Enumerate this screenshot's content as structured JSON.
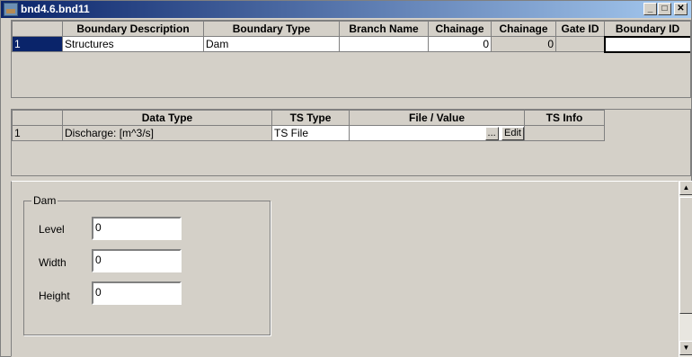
{
  "window": {
    "title": "bnd4.6.bnd11",
    "minimize": "_",
    "maximize": "□",
    "close": "✕"
  },
  "boundary_table": {
    "headers": [
      "",
      "Boundary Description",
      "Boundary Type",
      "Branch Name",
      "Chainage",
      "Chainage",
      "Gate ID",
      "Boundary ID"
    ],
    "rows": [
      [
        "1",
        "Structures",
        "Dam",
        "",
        "0",
        "0",
        "",
        ""
      ]
    ]
  },
  "ts_table": {
    "headers": [
      "",
      "Data Type",
      "TS Type",
      "File / Value",
      "TS Info"
    ],
    "rows": [
      [
        "1",
        "Discharge:  [m^3/s]",
        "TS File",
        "",
        ""
      ]
    ],
    "browse_label": "...",
    "edit_label": "Edit"
  },
  "dam_group": {
    "legend": "Dam",
    "fields": [
      {
        "label": "Level",
        "value": "0"
      },
      {
        "label": "Width",
        "value": "0"
      },
      {
        "label": "Height",
        "value": "0"
      }
    ]
  },
  "scrollbar": {
    "up": "▲",
    "down": "▼"
  }
}
